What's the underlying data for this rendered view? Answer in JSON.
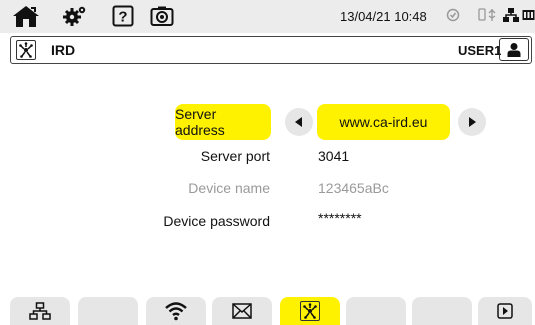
{
  "status_bar": {
    "datetime": "13/04/21 10:48",
    "icons": [
      "home-icon",
      "gear-icon",
      "help-icon",
      "camera-icon",
      "status-ok-icon",
      "usb-icon",
      "network-icon",
      "battery-icon"
    ],
    "help_glyph": "?"
  },
  "title_bar": {
    "title": "IRD",
    "user": "USER1",
    "icon": "ird-icon"
  },
  "form": {
    "server_address": {
      "label": "Server address",
      "value": "www.ca-ird.eu"
    },
    "server_port": {
      "label": "Server port",
      "value": "3041"
    },
    "device_name": {
      "label": "Device name",
      "value": "123465aBc"
    },
    "device_password": {
      "label": "Device password",
      "value": "********"
    }
  },
  "tabs": [
    {
      "icon": "ethernet-icon",
      "active": false
    },
    {
      "icon": "",
      "active": false
    },
    {
      "icon": "wifi-icon",
      "active": false
    },
    {
      "icon": "email-icon",
      "active": false
    },
    {
      "icon": "ird-icon",
      "active": true
    },
    {
      "icon": "",
      "active": false
    },
    {
      "icon": "",
      "active": false
    },
    {
      "icon": "",
      "active": false
    },
    {
      "icon": "next-page-icon",
      "active": false
    }
  ],
  "colors": {
    "highlight": "#fff200",
    "inactive_tab": "#e6e6e6",
    "status_bar": "#ececec",
    "muted_text": "#9a9a9a"
  }
}
